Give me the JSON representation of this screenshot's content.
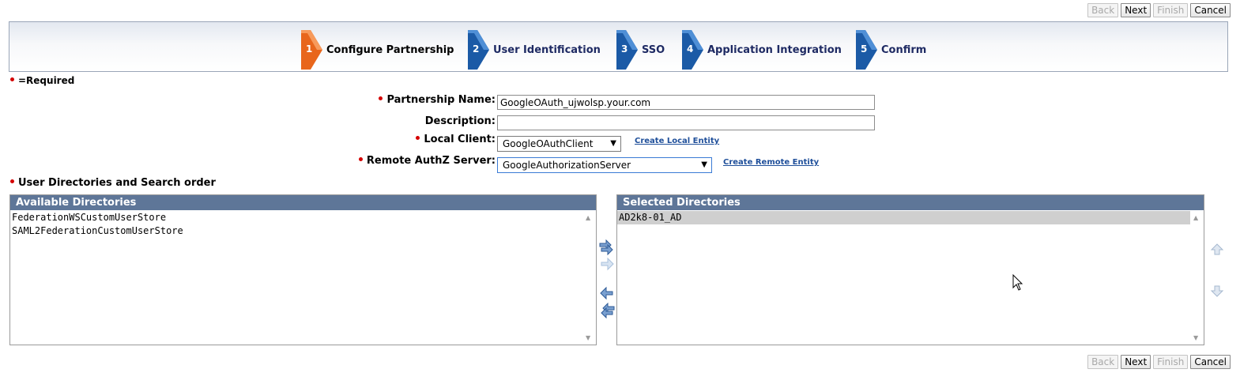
{
  "buttons": {
    "back": "Back",
    "next": "Next",
    "finish": "Finish",
    "cancel": "Cancel"
  },
  "wizard": {
    "steps": [
      {
        "num": "1",
        "label": "Configure Partnership",
        "active": true
      },
      {
        "num": "2",
        "label": "User Identification"
      },
      {
        "num": "3",
        "label": "SSO"
      },
      {
        "num": "4",
        "label": "Application Integration"
      },
      {
        "num": "5",
        "label": "Confirm"
      }
    ]
  },
  "required_note": "=Required",
  "form": {
    "partnership_name": {
      "label": "Partnership Name:",
      "value": "GoogleOAuth_ujwolsp.your.com"
    },
    "description": {
      "label": "Description:",
      "value": ""
    },
    "local_client": {
      "label": "Local Client:",
      "value": "GoogleOAuthClient",
      "link": "Create Local Entity"
    },
    "remote_authz": {
      "label": "Remote AuthZ Server:",
      "value": "GoogleAuthorizationServer",
      "link": "Create Remote Entity"
    }
  },
  "directories": {
    "section_title": "User Directories and Search order",
    "available": {
      "header": "Available Directories",
      "items": [
        "FederationWSCustomUserStore",
        "SAML2FederationCustomUserStore"
      ]
    },
    "selected": {
      "header": "Selected Directories",
      "items": [
        "AD2k8-01_AD"
      ]
    }
  },
  "colors": {
    "active_step": "#e8661c",
    "inactive_step": "#1b5aa6",
    "list_header": "#5e7698",
    "required": "#d40000",
    "link": "#1f4f9a"
  }
}
